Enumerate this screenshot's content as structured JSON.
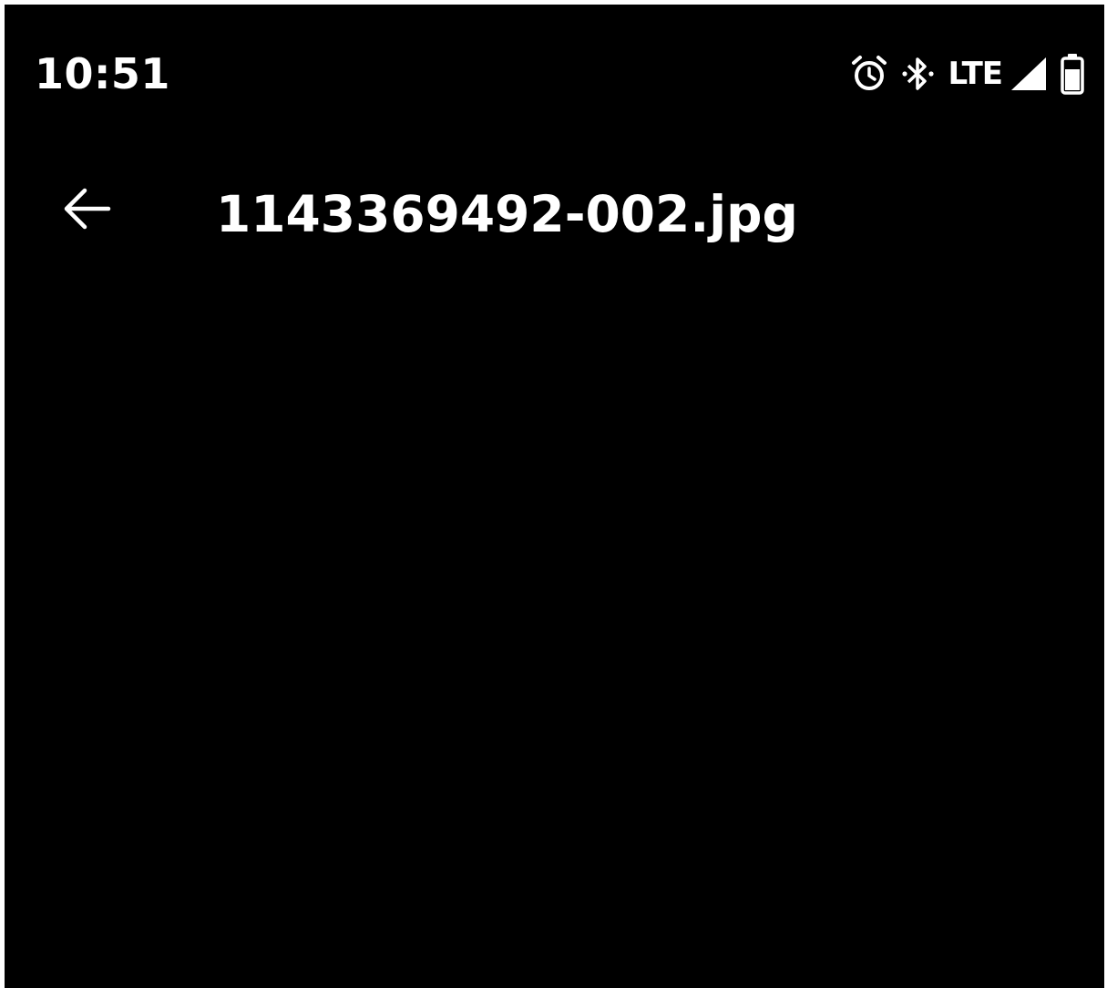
{
  "status_bar": {
    "time": "10:51",
    "network_label": "LTE",
    "icons": [
      "alarm-icon",
      "bluetooth-icon",
      "cellular-signal-icon",
      "battery-icon"
    ]
  },
  "app_bar": {
    "back_icon": "arrow-back-icon",
    "title": "1143369492-002.jpg"
  },
  "colors": {
    "background": "#000000",
    "foreground": "#ffffff"
  }
}
